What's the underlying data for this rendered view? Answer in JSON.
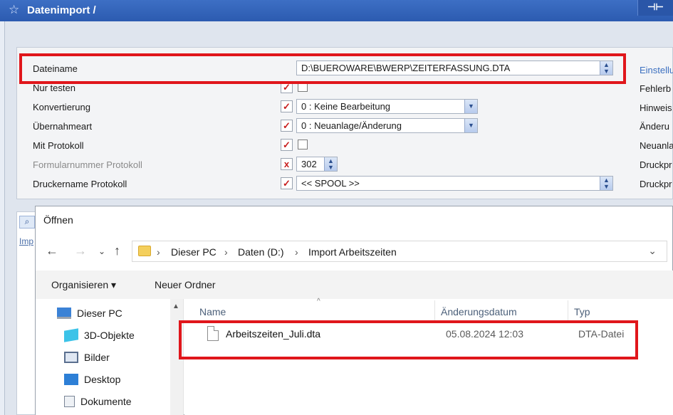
{
  "window": {
    "title": "Datenimport /",
    "pin_glyph": "⊣⊢"
  },
  "settings": {
    "rows": [
      {
        "label": "Dateiname",
        "value": "D:\\BUEROWARE\\BWERP\\ZEITERFASSUNG.DTA"
      },
      {
        "label": "Nur testen"
      },
      {
        "label": "Konvertierung",
        "value": "0 : Keine Bearbeitung"
      },
      {
        "label": "Übernahmeart",
        "value": "0 : Neuanlage/Änderung"
      },
      {
        "label": "Mit Protokoll"
      },
      {
        "label": "Formularnummer Protokoll",
        "value": "302"
      },
      {
        "label": "Druckername Protokoll",
        "value": "<< SPOOL >>"
      }
    ],
    "check_mark": "✓",
    "cross_mark": "x",
    "right_column": [
      "Einstellu",
      "Fehlerb",
      "Hinweis",
      "Änderu",
      "Neuanla",
      "Druckpr",
      "Druckpr"
    ]
  },
  "dialog": {
    "title": "Öffnen",
    "path": [
      "Dieser PC",
      "Daten (D:)",
      "Import Arbeitszeiten"
    ],
    "path_sep": "›",
    "toolbar": {
      "organize": "Organisieren ▾",
      "new_folder": "Neuer Ordner"
    },
    "nav_tree": [
      {
        "label": "Dieser PC",
        "icon": "computer-icon"
      },
      {
        "label": "3D-Objekte",
        "icon": "cube-icon"
      },
      {
        "label": "Bilder",
        "icon": "pictures-icon"
      },
      {
        "label": "Desktop",
        "icon": "desktop-icon"
      },
      {
        "label": "Dokumente",
        "icon": "documents-icon"
      }
    ],
    "columns": {
      "name": "Name",
      "date": "Änderungsdatum",
      "type": "Typ"
    },
    "files": [
      {
        "name": "Arbeitszeiten_Juli.dta",
        "date": "05.08.2024 12:03",
        "type": "DTA-Datei"
      }
    ]
  },
  "leftgrid": {
    "header": "Imp"
  },
  "colors": {
    "titlebar": "#2c5bb0",
    "highlight": "#e0161b",
    "link": "#3b6fc0"
  }
}
